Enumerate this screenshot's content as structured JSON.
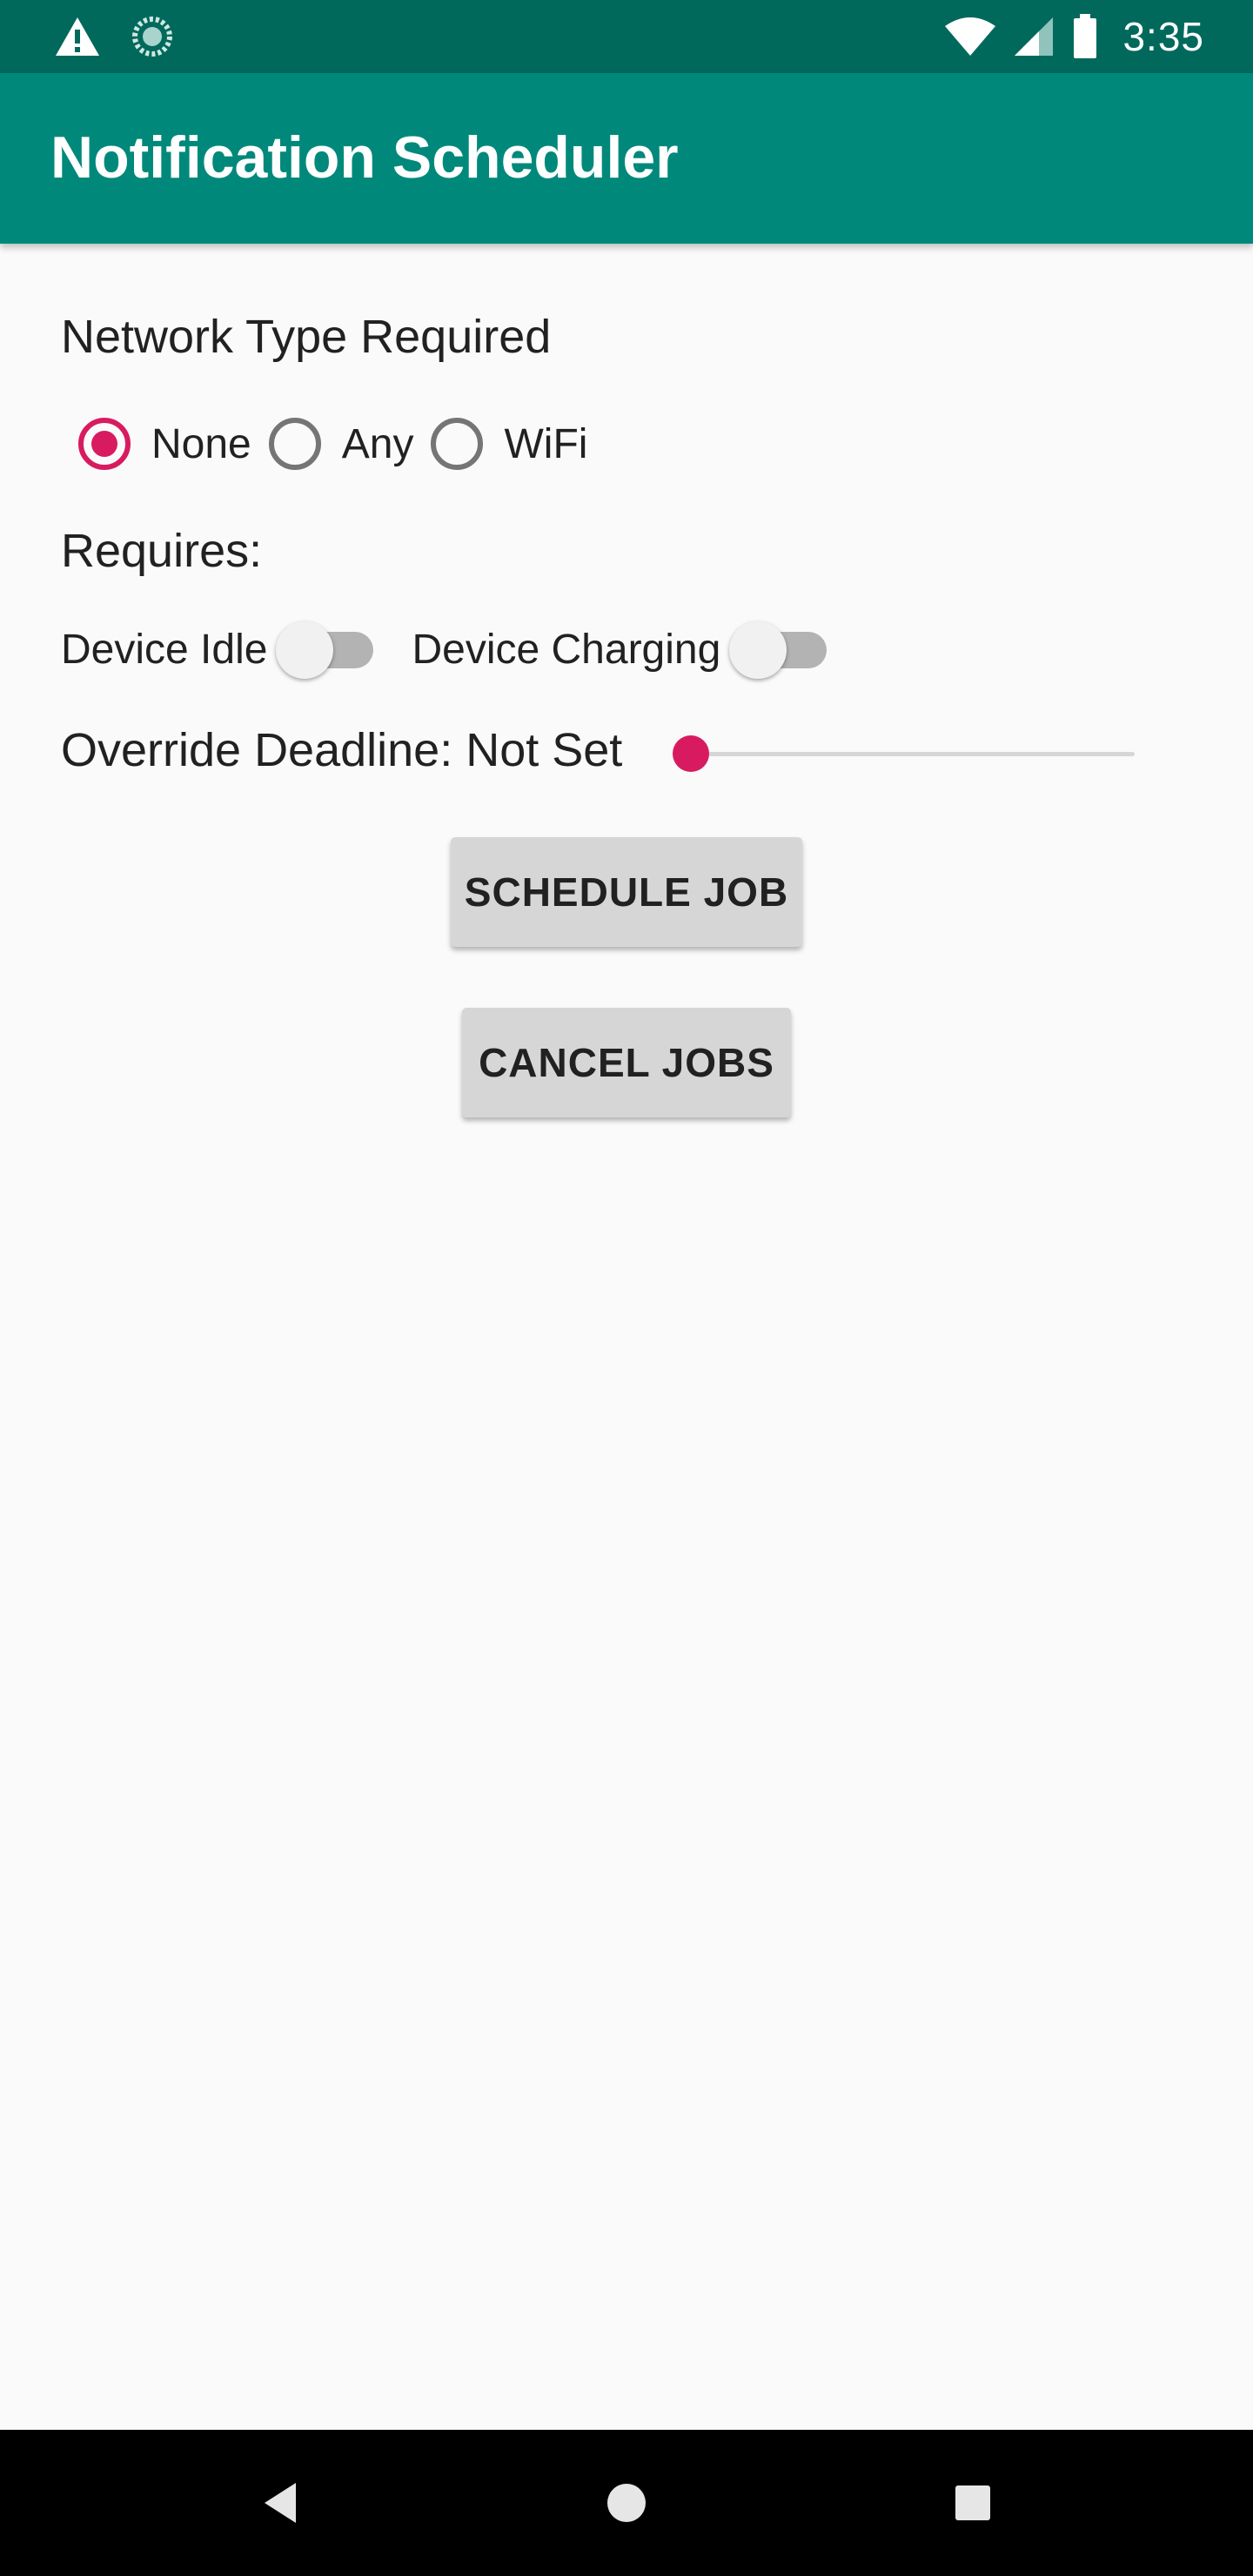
{
  "status_bar": {
    "time": "3:35",
    "icons_left": [
      "warning-icon",
      "sync-icon"
    ],
    "icons_right": [
      "wifi-icon",
      "signal-icon",
      "battery-icon"
    ]
  },
  "app_bar": {
    "title": "Notification Scheduler"
  },
  "network": {
    "heading": "Network Type Required",
    "options": [
      {
        "label": "None",
        "checked": true
      },
      {
        "label": "Any",
        "checked": false
      },
      {
        "label": "WiFi",
        "checked": false
      }
    ]
  },
  "requires": {
    "heading": "Requires:",
    "switches": [
      {
        "label": "Device Idle",
        "on": false
      },
      {
        "label": "Device Charging",
        "on": false
      }
    ]
  },
  "deadline": {
    "label": "Override Deadline: Not Set",
    "slider_fraction": 0
  },
  "buttons": {
    "schedule": "SCHEDULE JOB",
    "cancel": "CANCEL JOBS"
  },
  "nav_bar": {
    "icons": [
      "back-icon",
      "home-icon",
      "recents-icon"
    ]
  },
  "colors": {
    "status_bar": "#00695c",
    "app_bar": "#00897b",
    "accent": "#d81b60",
    "background": "#fafafa",
    "button": "#d6d6d6"
  }
}
